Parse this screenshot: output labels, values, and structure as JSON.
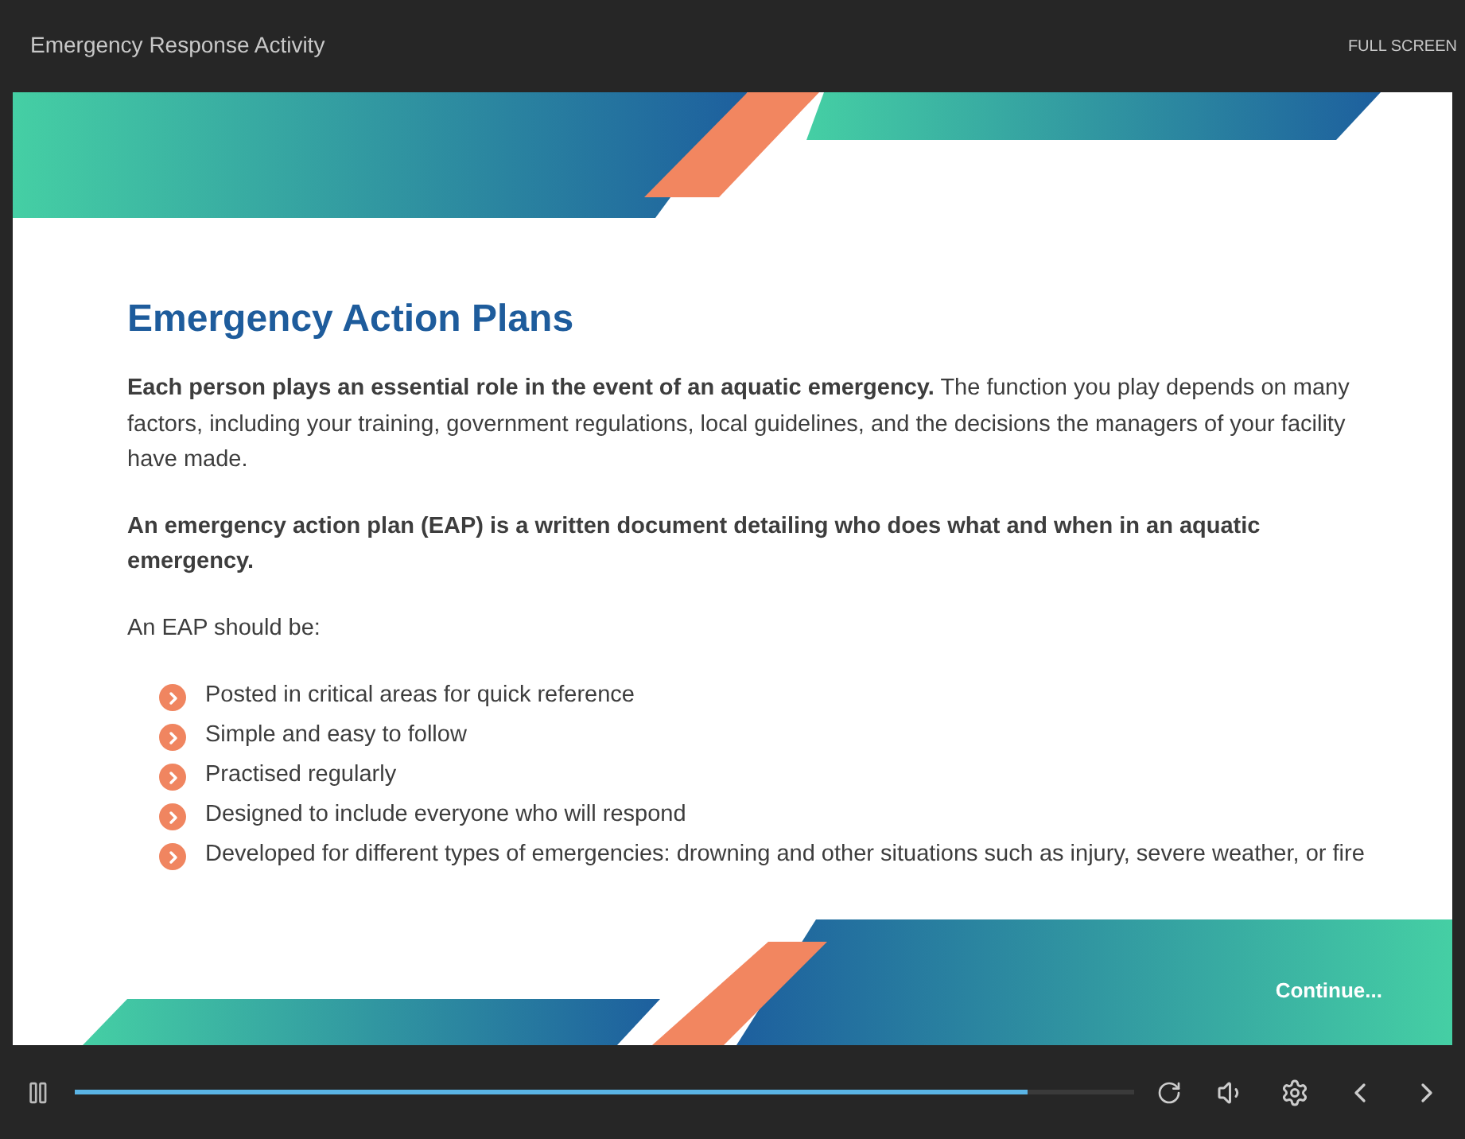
{
  "window": {
    "title": "Emergency Response Activity",
    "fullscreen_label": "FULL SCREEN"
  },
  "slide": {
    "heading": "Emergency Action Plans",
    "paragraphs": [
      "**Each person plays an essential role in the event of an aquatic emergency.** The function you play depends on many factors, including your training, government regulations, local guidelines, and the decisions the managers of your facility have made.",
      "**An emergency action plan (EAP) is a written document detailing who does what and when in an aquatic emergency.**",
      "An EAP should be:"
    ],
    "bullets": [
      "Posted in critical areas for quick reference",
      "Simple and easy to follow",
      "Practised regularly",
      "Designed to include everyone who will respond",
      "Developed for different types of emergencies: drowning and other situations such as injury, severe weather, or fire"
    ],
    "continue_label": "Continue..."
  },
  "player": {
    "progress": {
      "level": 0.9
    }
  }
}
